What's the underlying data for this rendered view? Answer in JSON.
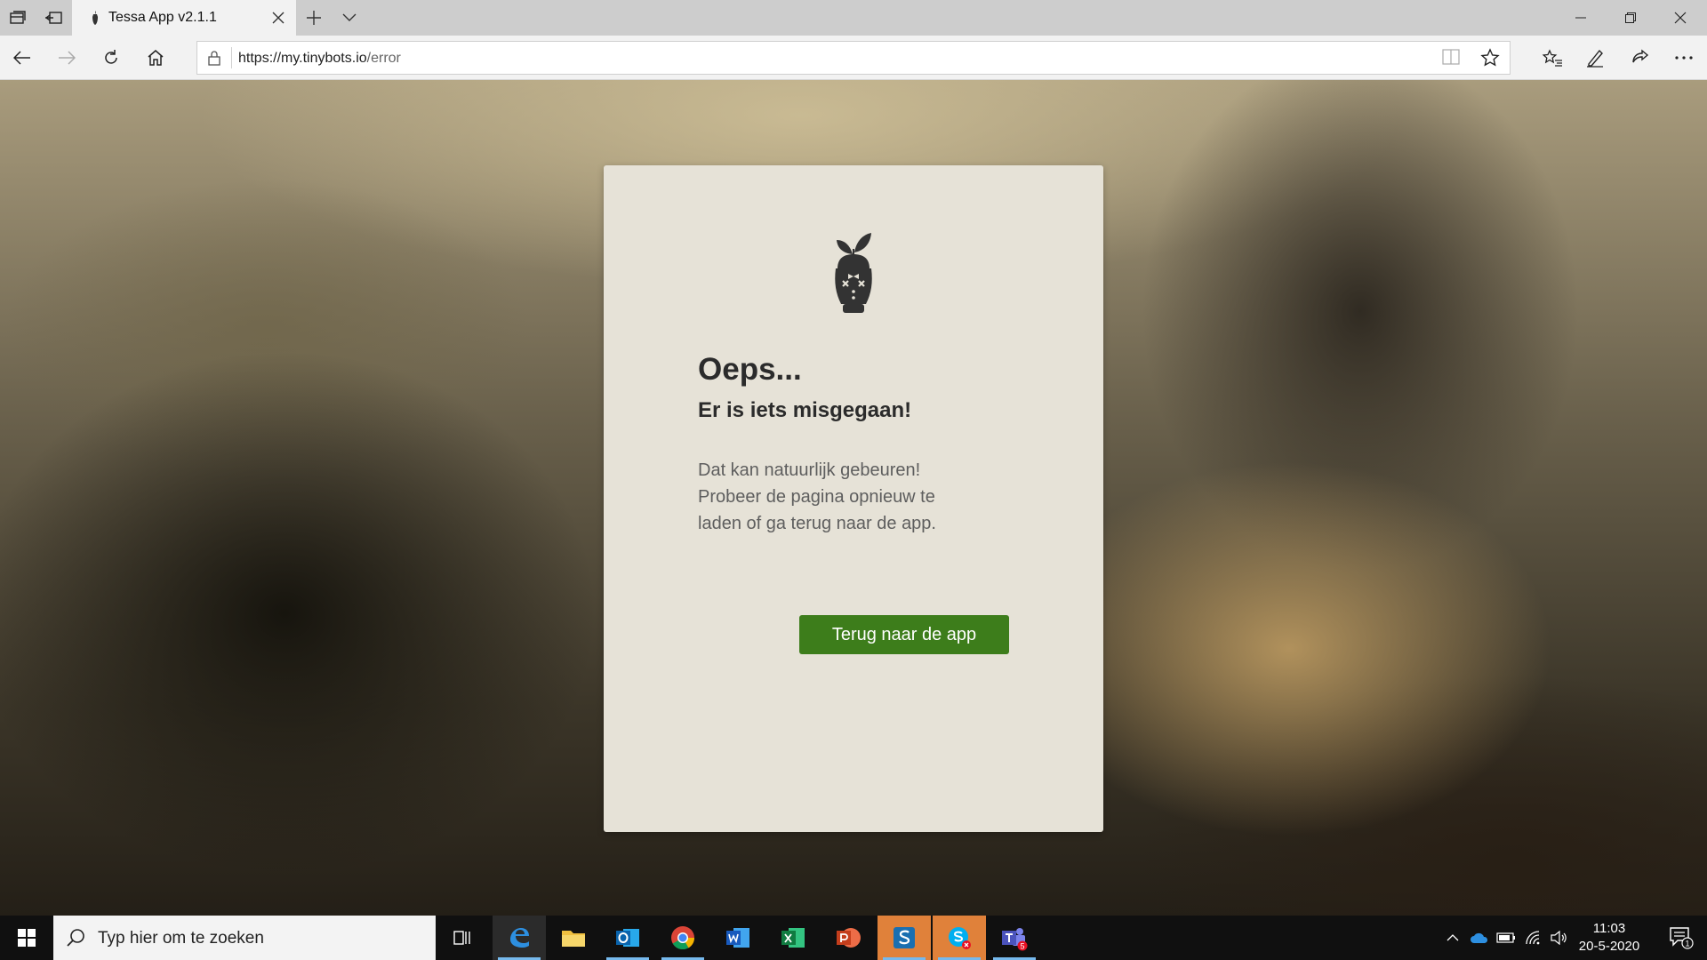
{
  "browser": {
    "tab_title": "Tessa App v2.1.1",
    "url_host": "https://my.tinybots.io",
    "url_path": "/error"
  },
  "error_card": {
    "heading": "Oeps...",
    "subheading": "Er is iets misgegaan!",
    "line1": "Dat kan natuurlijk gebeuren!",
    "line2": "Probeer de pagina opnieuw te",
    "line3": "laden of ga terug naar de app.",
    "button_label": "Terug naar de app",
    "button_color": "#3d7d1b"
  },
  "taskbar": {
    "search_placeholder": "Typ hier om te zoeken",
    "time": "11:03",
    "date": "20-5-2020",
    "teams_badge": "5",
    "notification_count": "1",
    "apps": [
      "edge-icon",
      "file-explorer-icon",
      "outlook-icon",
      "chrome-icon",
      "word-icon",
      "excel-icon",
      "powerpoint-icon",
      "sway-icon",
      "skype-icon",
      "teams-icon"
    ]
  }
}
